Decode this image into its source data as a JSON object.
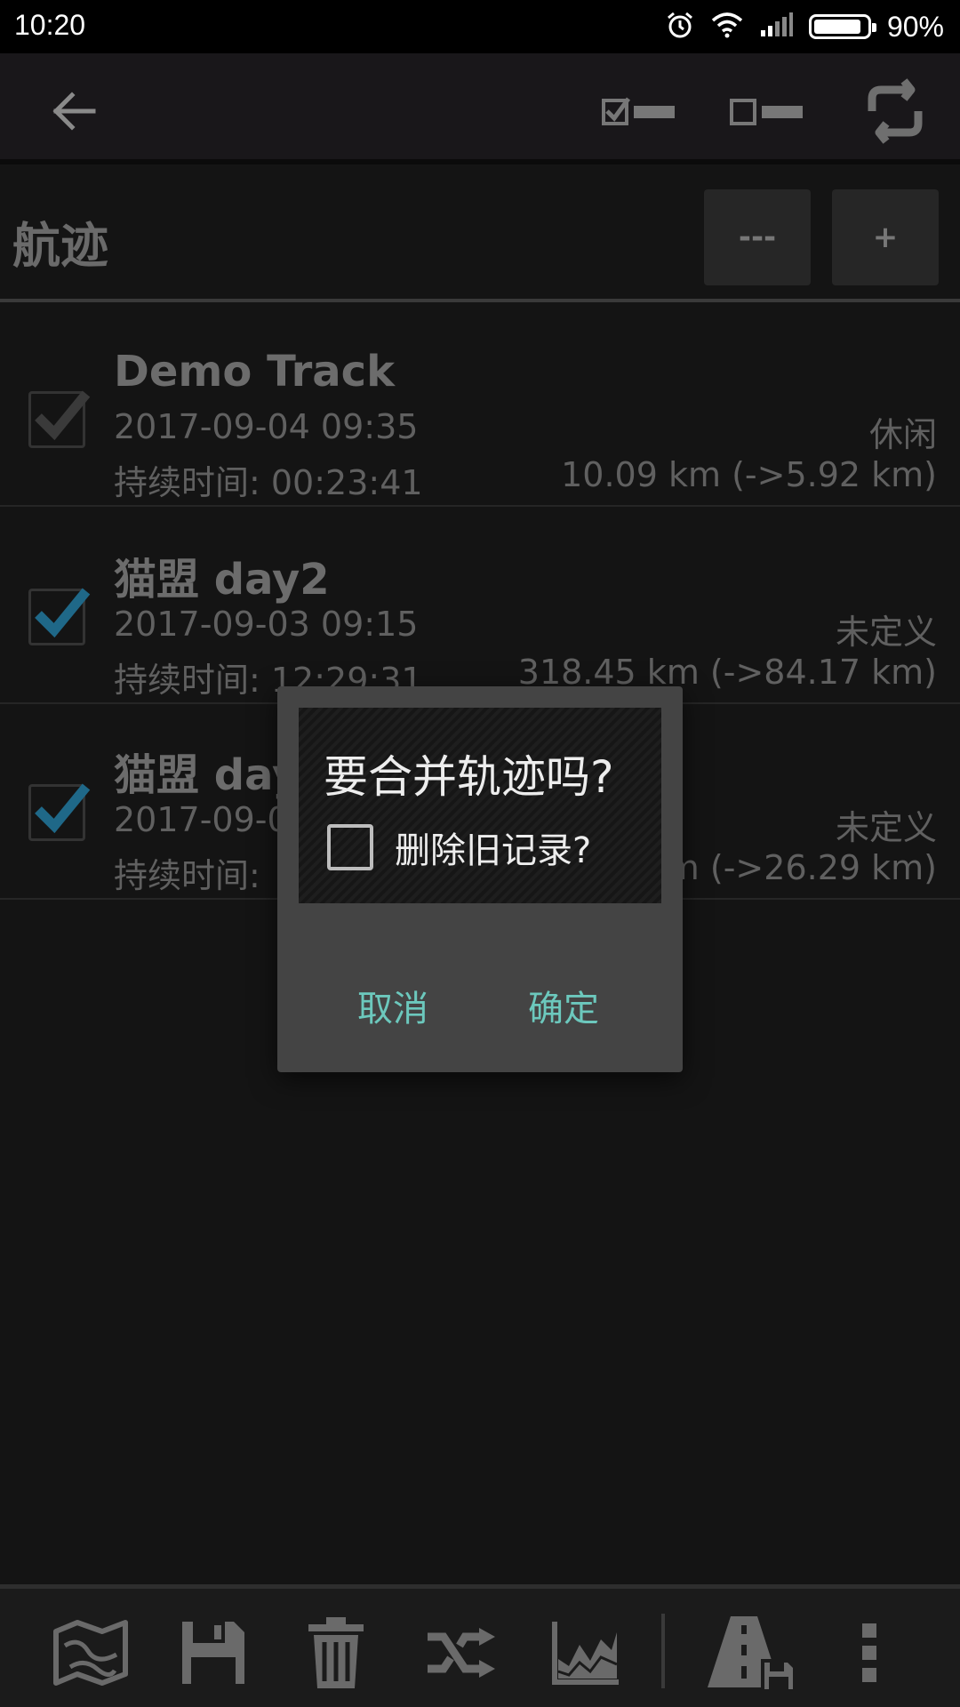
{
  "status_bar": {
    "time": "10:20",
    "battery_percent": "90%",
    "battery_level": 0.9
  },
  "toolbar": {
    "back_icon": "arrow-left-icon",
    "select_all_icon": "check-all-icon",
    "deselect_all_icon": "uncheck-all-icon",
    "sync_icon": "sync-icon"
  },
  "section": {
    "title": "航迹",
    "minus_label": "---",
    "plus_label": "+"
  },
  "tracks": [
    {
      "name": "Demo Track",
      "date": "2017-09-04 09:35",
      "category": "休闲",
      "duration": "持续时间: 00:23:41",
      "distance": "10.09 km (->5.92 km)",
      "checked": true
    },
    {
      "name": "猫盟 day2",
      "date": "2017-09-03 09:15",
      "category": "未定义",
      "duration": "持续时间: 12:29:31",
      "distance": "318.45 km (->84.17 km)",
      "checked": true
    },
    {
      "name": "猫盟 day",
      "date": "2017-09-0",
      "category": "未定义",
      "duration": "持续时间:",
      "distance": "km (->26.29 km)",
      "checked": true
    }
  ],
  "dialog": {
    "question": "要合并轨迹吗?",
    "option_label": "删除旧记录?",
    "option_checked": false,
    "cancel_label": "取消",
    "confirm_label": "确定"
  },
  "bottom_bar": {
    "icons": [
      "map-icon",
      "save-icon",
      "trash-icon",
      "merge-icon",
      "chart-icon",
      "road-save-icon",
      "more-vert-icon"
    ]
  },
  "colors": {
    "accent": "#6cc8bd",
    "check_blue": "#2a86b0"
  }
}
